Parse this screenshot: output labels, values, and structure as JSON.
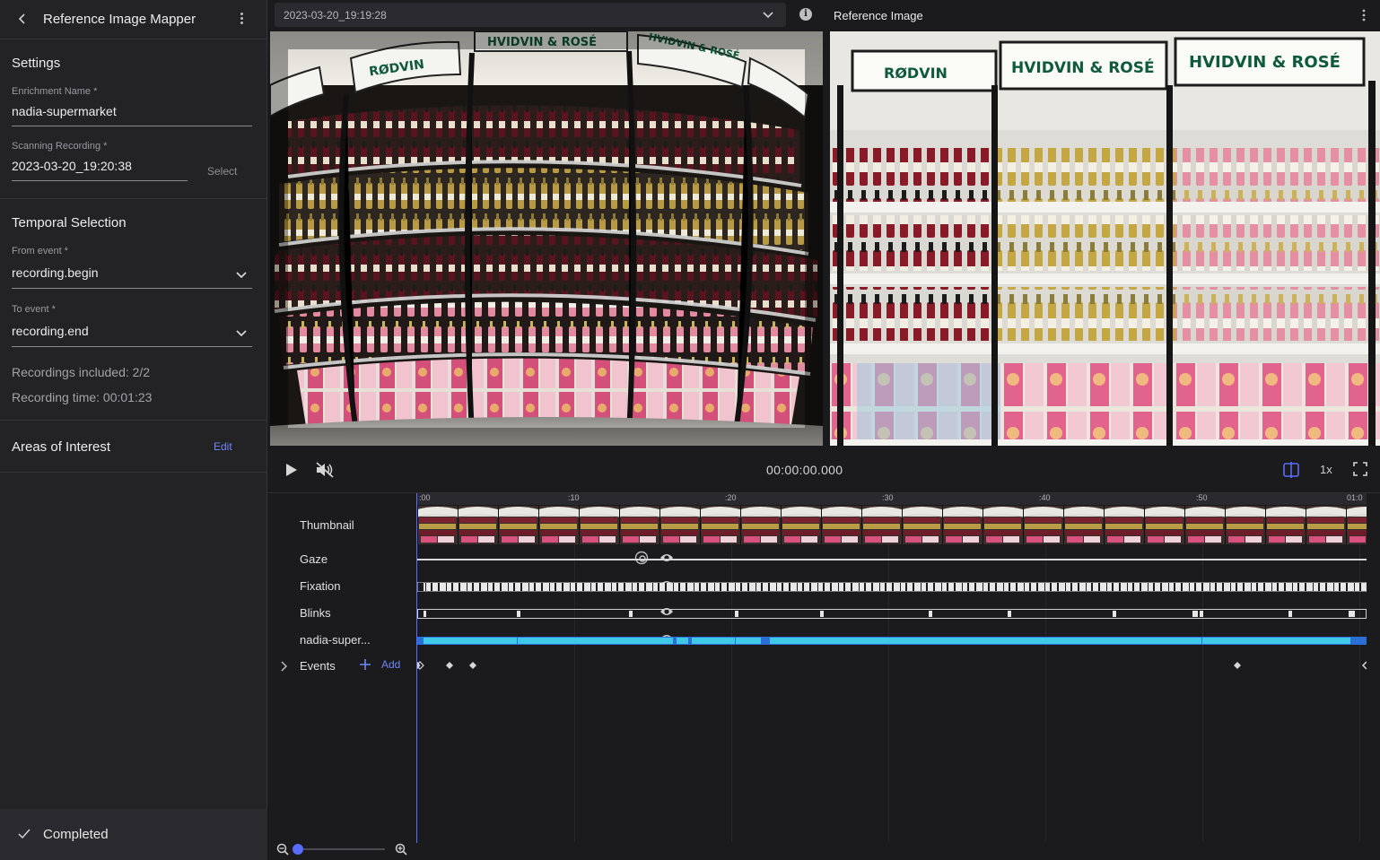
{
  "sidebar": {
    "title": "Reference Image Mapper",
    "settings_title": "Settings",
    "enrichment_label": "Enrichment Name *",
    "enrichment_value": "nadia-supermarket",
    "scanning_label": "Scanning Recording *",
    "scanning_value": "2023-03-20_19:20:38",
    "select_label": "Select",
    "temporal_title": "Temporal Selection",
    "from_label": "From event *",
    "from_value": "recording.begin",
    "to_label": "To event *",
    "to_value": "recording.end",
    "recordings_included": "Recordings included: 2/2",
    "recording_time": "Recording time: 00:01:23",
    "aoi_title": "Areas of Interest",
    "aoi_edit": "Edit",
    "status": "Completed"
  },
  "topbar": {
    "recording_select": "2023-03-20_19:19:28",
    "reference_title": "Reference Image"
  },
  "player": {
    "timecode": "00:00:00.000",
    "speed": "1x"
  },
  "timeline": {
    "ticks": [
      ":00",
      ":10",
      ":20",
      ":30",
      ":40",
      ":50",
      "01:0"
    ],
    "rows": {
      "thumbnail": "Thumbnail",
      "gaze": "Gaze",
      "fixation": "Fixation",
      "blinks": "Blinks",
      "enrichment": "nadia-super...",
      "events": "Events"
    },
    "add_label": "Add",
    "zoom_level": 0.0
  },
  "colors": {
    "accent": "#5a6cff",
    "link": "#6e86ff",
    "enrichment_track": "#3fc8e8",
    "enrichment_track_dark": "#2b6fd6"
  },
  "icons": {
    "back": "chevron-left-icon",
    "menu": "kebab-menu-icon",
    "play": "play-icon",
    "mute": "volume-off-icon",
    "split": "split-view-icon",
    "fullscreen": "fullscreen-icon",
    "eye": "eye-icon",
    "gaze_overlay": "gaze-circle-icon",
    "expand": "chevron-right-icon",
    "add": "plus-icon",
    "zoom_out": "zoom-out-icon",
    "zoom_in": "zoom-in-icon",
    "check": "check-icon",
    "info": "info-icon"
  }
}
